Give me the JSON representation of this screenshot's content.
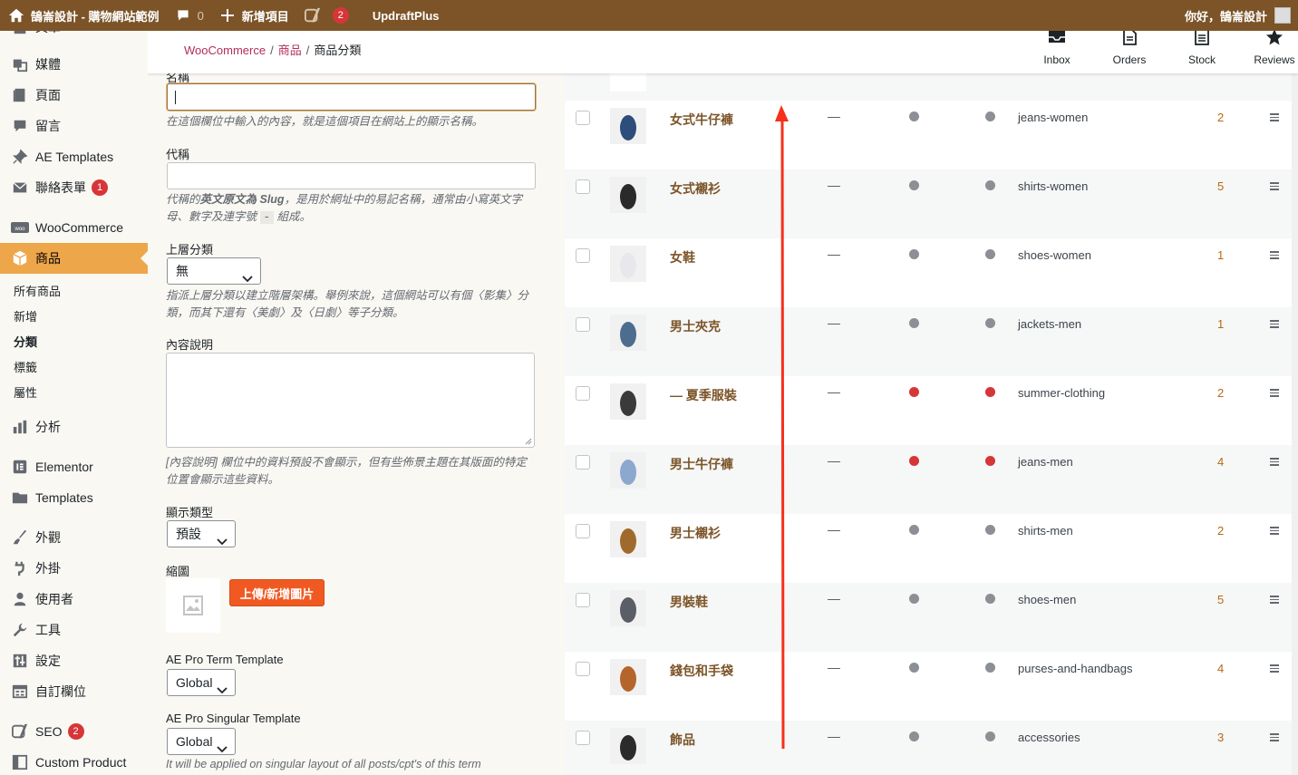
{
  "adminbar": {
    "site_name": "鵠崙設計 - 購物網站範例",
    "comments_count": "0",
    "new_label": "新增項目",
    "yoast_count": "2",
    "updraft_label": "UpdraftPlus",
    "greeting": "你好，鵠崙設計"
  },
  "sidebar": {
    "partial_top": "文章",
    "items": [
      {
        "label": "媒體",
        "icon": "media-icon"
      },
      {
        "label": "頁面",
        "icon": "page-icon"
      },
      {
        "label": "留言",
        "icon": "comment-icon"
      },
      {
        "label": "AE Templates",
        "icon": "pin-icon"
      },
      {
        "label": "聯絡表單",
        "icon": "mail-icon",
        "badge": "1"
      }
    ],
    "woocommerce": "WooCommerce",
    "products": "商品",
    "submenu": [
      "所有商品",
      "新增",
      "分類",
      "標籤",
      "屬性"
    ],
    "current_sub": "分類",
    "analytics": "分析",
    "elementor": "Elementor",
    "templates": "Templates",
    "appearance": "外觀",
    "plugins": "外掛",
    "users": "使用者",
    "tools": "工具",
    "settings": "設定",
    "custom_fields": "自訂欄位",
    "seo": "SEO",
    "seo_badge": "2",
    "custom_product": "Custom Product"
  },
  "header": {
    "breadcrumb": [
      "WooCommerce",
      "商品",
      "商品分類"
    ],
    "tabs": [
      {
        "label": "Inbox",
        "icon": "inbox-icon"
      },
      {
        "label": "Orders",
        "icon": "orders-icon"
      },
      {
        "label": "Stock",
        "icon": "stock-icon"
      },
      {
        "label": "Reviews",
        "icon": "star-icon"
      }
    ]
  },
  "form": {
    "name_label_partial": "名稱",
    "name_value": "",
    "name_desc": "在這個欄位中輸入的內容，就是這個項目在網站上的顯示名稱。",
    "slug_label": "代稱",
    "slug_value": "",
    "slug_desc_1": "代稱的",
    "slug_desc_bold": "英文原文為 Slug",
    "slug_desc_2": "，是用於網址中的易記名稱，通常由小寫英文字母、數字及連字號",
    "slug_desc_code": "-",
    "slug_desc_3": "組成。",
    "parent_label": "上層分類",
    "parent_value": "無",
    "parent_desc": "指派上層分類以建立階層架構。舉例來說，這個網站可以有個〈影集〉分類，而其下還有〈美劇〉及〈日劇〉等子分類。",
    "desc_label": "內容說明",
    "desc_help": "[內容說明] 欄位中的資料預設不會顯示，但有些佈景主題在其版面的特定位置會顯示這些資料。",
    "display_type_label": "顯示類型",
    "display_type_value": "預設",
    "thumbnail_label": "縮圖",
    "upload_button": "上傳/新增圖片",
    "ae_term_label": "AE Pro Term Template",
    "ae_term_value": "Global",
    "ae_singular_label": "AE Pro Singular Template",
    "ae_singular_value": "Global",
    "ae_singular_desc": "It will be applied on singular layout of all posts/cpt's of this term"
  },
  "table": {
    "rows": [
      {
        "name": "女式牛仔褲",
        "desc": "—",
        "dot1": "#8c8f94",
        "dot2": "#8c8f94",
        "slug": "jeans-women",
        "count": "2",
        "thumb": "jeans-women"
      },
      {
        "name": "女式襯衫",
        "desc": "—",
        "dot1": "#8c8f94",
        "dot2": "#8c8f94",
        "slug": "shirts-women",
        "count": "5",
        "thumb": "shirts-women"
      },
      {
        "name": "女鞋",
        "desc": "—",
        "dot1": "#8c8f94",
        "dot2": "#8c8f94",
        "slug": "shoes-women",
        "count": "1",
        "thumb": "shoes-women"
      },
      {
        "name": "男士夾克",
        "desc": "—",
        "dot1": "#8c8f94",
        "dot2": "#8c8f94",
        "slug": "jackets-men",
        "count": "1",
        "thumb": "jackets-men"
      },
      {
        "name": "— 夏季服裝",
        "desc": "—",
        "dot1": "#d63638",
        "dot2": "#d63638",
        "slug": "summer-clothing",
        "count": "2",
        "thumb": "summer-clothing"
      },
      {
        "name": "男士牛仔褲",
        "desc": "—",
        "dot1": "#d63638",
        "dot2": "#d63638",
        "slug": "jeans-men",
        "count": "4",
        "thumb": "jeans-men"
      },
      {
        "name": "男士襯衫",
        "desc": "—",
        "dot1": "#8c8f94",
        "dot2": "#8c8f94",
        "slug": "shirts-men",
        "count": "2",
        "thumb": "shirts-men"
      },
      {
        "name": "男裝鞋",
        "desc": "—",
        "dot1": "#8c8f94",
        "dot2": "#8c8f94",
        "slug": "shoes-men",
        "count": "5",
        "thumb": "shoes-men"
      },
      {
        "name": "錢包和手袋",
        "desc": "—",
        "dot1": "#8c8f94",
        "dot2": "#8c8f94",
        "slug": "purses-and-handbags",
        "count": "4",
        "thumb": "purses-and-handbags"
      },
      {
        "name": "飾品",
        "desc": "—",
        "dot1": "#8c8f94",
        "dot2": "#8c8f94",
        "slug": "accessories",
        "count": "3",
        "thumb": "accessories"
      }
    ]
  },
  "colors": {
    "adminbar": "#7c5428",
    "accent": "#eea64a",
    "button": "#f05a22",
    "arrow": "#f5301c"
  }
}
